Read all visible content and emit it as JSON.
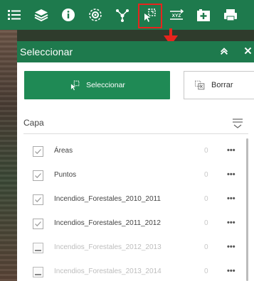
{
  "colors": {
    "toolbar_bg": "#1e7a4d",
    "primary_button": "#1f8a55",
    "highlight": "#e8231d"
  },
  "toolbar": {
    "tools": [
      {
        "name": "list-icon",
        "active": false
      },
      {
        "name": "layers-icon",
        "active": false
      },
      {
        "name": "info-icon",
        "active": false
      },
      {
        "name": "basemap-gallery-icon",
        "active": false
      },
      {
        "name": "network-icon",
        "active": false
      },
      {
        "name": "select-icon",
        "active": true
      },
      {
        "name": "xyz-icon",
        "active": false
      },
      {
        "name": "add-data-icon",
        "active": false
      },
      {
        "name": "print-icon",
        "active": false
      }
    ],
    "xyz_label": "XYZ"
  },
  "panel": {
    "title": "Seleccionar",
    "select_label": "Seleccionar",
    "clear_label": "Borrar",
    "layer_header": "Capa",
    "layers": [
      {
        "name": "Áreas",
        "checked": true,
        "count": "0",
        "dim": false
      },
      {
        "name": "Puntos",
        "checked": true,
        "count": "0",
        "dim": false
      },
      {
        "name": "Incendios_Forestales_2010_2011",
        "checked": true,
        "count": "0",
        "dim": false
      },
      {
        "name": "Incendios_Forestales_2011_2012",
        "checked": true,
        "count": "0",
        "dim": false
      },
      {
        "name": "Incendios_Forestales_2012_2013",
        "checked": false,
        "count": "0",
        "dim": true
      },
      {
        "name": "Incendios_Forestales_2013_2014",
        "checked": false,
        "count": "0",
        "dim": true
      }
    ],
    "more_label": "•••"
  }
}
